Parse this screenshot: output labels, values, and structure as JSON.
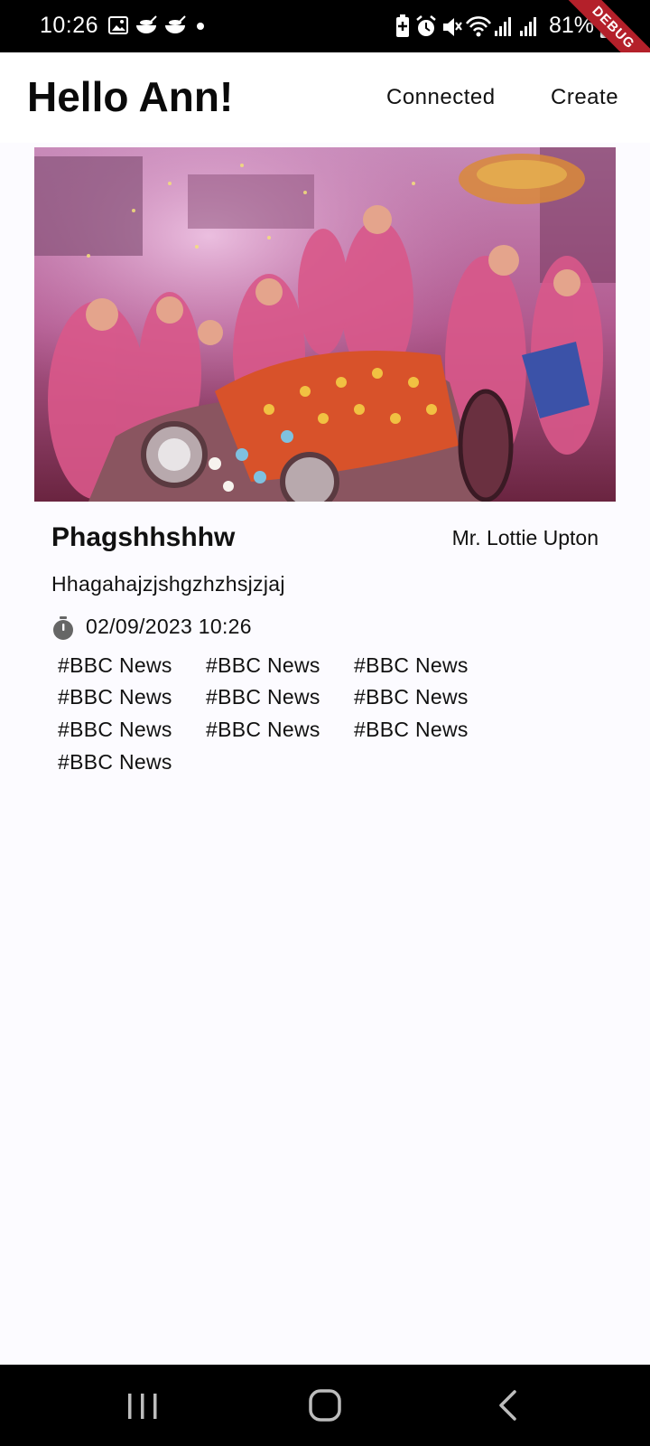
{
  "status_bar": {
    "time": "10:26",
    "battery": "81%",
    "left_icons": [
      "image-icon",
      "food-bowl-icon",
      "food-bowl-icon",
      "dot-icon"
    ],
    "right_icons": [
      "battery-saver-icon",
      "alarm-icon",
      "mute-icon",
      "wifi-icon",
      "signal-icon",
      "signal-icon",
      "battery-icon"
    ]
  },
  "debug_banner": "DEBUG",
  "app_bar": {
    "greeting": "Hello Ann!",
    "nav_connected": "Connected",
    "nav_create": "Create"
  },
  "article": {
    "title": "Phagshhshhw",
    "author": "Mr. Lottie Upton",
    "description": "Hhagahajzjshgzhzhsjzjaj",
    "date": "02/09/2023 10:26",
    "tags": [
      "#BBC News",
      "#BBC News",
      "#BBC News",
      "#BBC News",
      "#BBC News",
      "#BBC News",
      "#BBC News",
      "#BBC News",
      "#BBC News",
      "#BBC News"
    ]
  },
  "colors": {
    "background": "#fcfbff",
    "app_bar": "#ffffff",
    "system_bars": "#000000",
    "debug_banner": "#b4202a"
  }
}
